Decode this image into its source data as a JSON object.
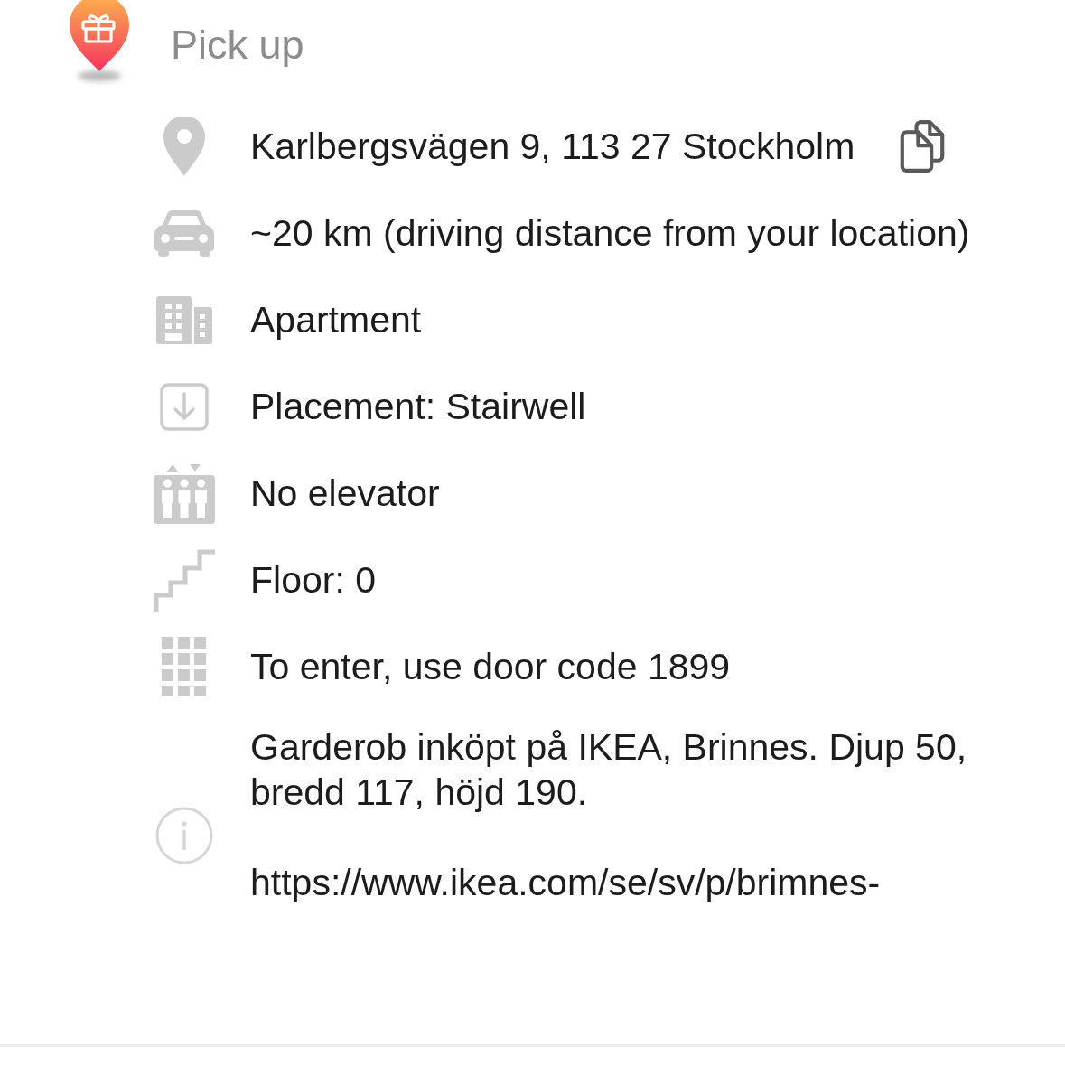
{
  "header": {
    "title": "Pick up"
  },
  "details": [
    {
      "kind": "address",
      "text": "Karlbergsvägen 9, 113 27 Stockholm"
    },
    {
      "kind": "distance",
      "text": "~20 km (driving distance from your location)"
    },
    {
      "kind": "building",
      "text": "Apartment"
    },
    {
      "kind": "placement",
      "text": "Placement: Stairwell"
    },
    {
      "kind": "elevator",
      "text": "No elevator"
    },
    {
      "kind": "floor",
      "text": "Floor: 0"
    },
    {
      "kind": "door_code",
      "text": "To enter, use door code 1899"
    }
  ],
  "notes": {
    "paragraphs": [
      "Garderob inköpt på IKEA, Brinnes. Djup 50, bredd 117, höjd 190.",
      "https://www.ikea.com/se/sv/p/brimnes-"
    ]
  }
}
